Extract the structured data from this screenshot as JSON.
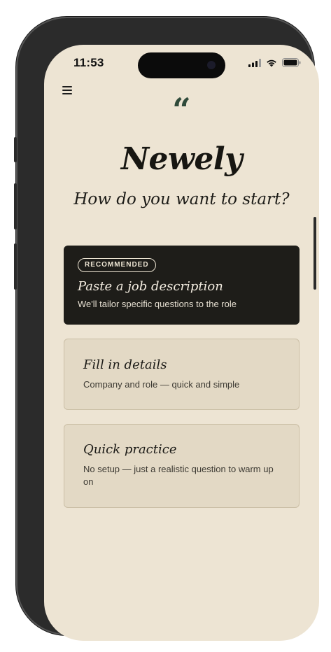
{
  "status_bar": {
    "time": "11:53"
  },
  "header": {
    "menu_icon": "hamburger-menu-icon",
    "quote_glyph": "“",
    "app_title": "Newely",
    "prompt": "How do you want to start?"
  },
  "options": [
    {
      "badge": "RECOMMENDED",
      "title": "Paste a job description",
      "description": "We'll tailor specific questions to the role"
    },
    {
      "title": "Fill in details",
      "description": "Company and role — quick and simple"
    },
    {
      "title": "Quick practice",
      "description": "No setup — just a realistic question to warm up on"
    }
  ],
  "colors": {
    "background": "#ede4d3",
    "accent_quote": "#2f4a3a",
    "dark_card": "#1e1d19",
    "light_card": "#e3d9c5"
  }
}
